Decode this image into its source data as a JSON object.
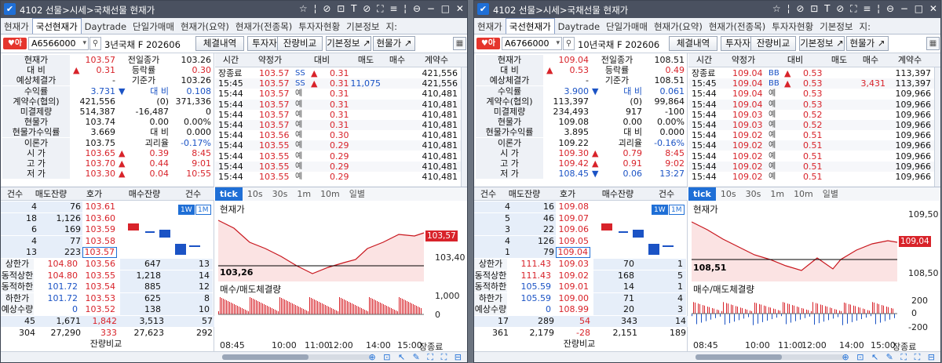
{
  "windows": [
    {
      "title": "4102 선물>시세>국채선물 현재가",
      "tabs": [
        "현재가",
        "국선현재가",
        "Daytrade",
        "단일가매매",
        "현재가(요약)",
        "현재가(전종목)",
        "투자자현황",
        "기본정보",
        "지:"
      ],
      "active_tab": 1,
      "code": "A6566000",
      "instrument": "3년국채 F 202606",
      "buttons": [
        "체결내역",
        "투자자",
        "잔량비교",
        "기본정보 ↗",
        "현물가 ↗"
      ],
      "summary": [
        {
          "label": "현재가",
          "value": "103.57",
          "color": "red",
          "label2": "전일종가",
          "value2": "103.26",
          "color2": ""
        },
        {
          "label": "대 비",
          "sign": "▲",
          "value": "0.31",
          "color": "red",
          "label2": "등락률",
          "value2": "0.30",
          "color2": "red"
        },
        {
          "label": "예상체결가",
          "value": "-",
          "color": "",
          "label2": "기준가",
          "value2": "103.26",
          "color2": ""
        },
        {
          "label": "수익률",
          "value": "3.731",
          "color": "blue",
          "label2": "대 비",
          "sign2": "▼",
          "value2": "0.108",
          "color2": "blue"
        },
        {
          "label": "계약수(협의)",
          "value": "421,556",
          "color": "",
          "label2": "(0)",
          "value2": "371,336",
          "color2": ""
        },
        {
          "label": "미결제량",
          "value": "514,387",
          "color": "",
          "label2": "-16,487",
          "value2": "0",
          "color2": ""
        },
        {
          "label": "현물가",
          "value": "103.74",
          "color": "",
          "label2": "0.00",
          "value2": "0.00%",
          "color2": ""
        },
        {
          "label": "현물가수익률",
          "value": "3.669",
          "color": "",
          "label2": "대 비",
          "value2": "0.000",
          "color2": ""
        },
        {
          "label": "이론가",
          "value": "103.75",
          "color": "",
          "label2": "괴리율",
          "value2": "-0.17%",
          "color2": "blue"
        },
        {
          "label": "시 가",
          "value": "103.65",
          "color": "red",
          "sign2": "▲",
          "label2": "0.39",
          "value2": "8:45",
          "color2": "red"
        },
        {
          "label": "고 가",
          "value": "103.70",
          "color": "red",
          "sign2": "▲",
          "label2": "0.44",
          "value2": "9:01",
          "color2": "red"
        },
        {
          "label": "저 가",
          "value": "103.30",
          "color": "red",
          "sign2": "▲",
          "label2": "0.04",
          "value2": "10:55",
          "color2": "red"
        }
      ],
      "trade_headers": [
        "시간",
        "약정가",
        "대비",
        "매도",
        "매수",
        "계약수"
      ],
      "trades": [
        {
          "time": "장종료",
          "price": "103.57",
          "tag": "SS",
          "sign": "▲",
          "chg": "0.31",
          "sell": "",
          "buy": "",
          "vol": "421,556"
        },
        {
          "time": "15:45",
          "price": "103.57",
          "tag": "SS",
          "sign": "▲",
          "chg": "0.31",
          "sell": "11,075",
          "buy": "",
          "vol": "421,556"
        },
        {
          "time": "15:44",
          "price": "103.57",
          "tag": "예",
          "sign": "",
          "chg": "0.31",
          "sell": "",
          "buy": "",
          "vol": "410,481"
        },
        {
          "time": "15:44",
          "price": "103.57",
          "tag": "예",
          "sign": "",
          "chg": "0.31",
          "sell": "",
          "buy": "",
          "vol": "410,481"
        },
        {
          "time": "15:44",
          "price": "103.57",
          "tag": "예",
          "sign": "",
          "chg": "0.31",
          "sell": "",
          "buy": "",
          "vol": "410,481"
        },
        {
          "time": "15:44",
          "price": "103.57",
          "tag": "예",
          "sign": "",
          "chg": "0.31",
          "sell": "",
          "buy": "",
          "vol": "410,481"
        },
        {
          "time": "15:44",
          "price": "103.56",
          "tag": "예",
          "sign": "",
          "chg": "0.30",
          "sell": "",
          "buy": "",
          "vol": "410,481"
        },
        {
          "time": "15:44",
          "price": "103.55",
          "tag": "예",
          "sign": "",
          "chg": "0.29",
          "sell": "",
          "buy": "",
          "vol": "410,481"
        },
        {
          "time": "15:44",
          "price": "103.55",
          "tag": "예",
          "sign": "",
          "chg": "0.29",
          "sell": "",
          "buy": "",
          "vol": "410,481"
        },
        {
          "time": "15:44",
          "price": "103.55",
          "tag": "예",
          "sign": "",
          "chg": "0.29",
          "sell": "",
          "buy": "",
          "vol": "410,481"
        },
        {
          "time": "15:44",
          "price": "103.55",
          "tag": "예",
          "sign": "",
          "chg": "0.29",
          "sell": "",
          "buy": "",
          "vol": "410,481"
        }
      ],
      "ob_headers": [
        "건수",
        "매도잔량",
        "호가",
        "매수잔량",
        "건수"
      ],
      "asks": [
        {
          "cnt": "4",
          "qty": "76",
          "price": "103.61"
        },
        {
          "cnt": "18",
          "qty": "1,126",
          "price": "103.60"
        },
        {
          "cnt": "6",
          "qty": "169",
          "price": "103.59"
        },
        {
          "cnt": "4",
          "qty": "77",
          "price": "103.58"
        },
        {
          "cnt": "13",
          "qty": "223",
          "price": "103.57"
        }
      ],
      "bids": [
        {
          "lab": "상한가",
          "lv": "104.80",
          "price": "103.56",
          "qty": "647",
          "cnt": "13"
        },
        {
          "lab": "동적상한",
          "lv": "104.80",
          "price": "103.55",
          "qty": "1,218",
          "cnt": "14"
        },
        {
          "lab": "동적하한",
          "lv": "101.72",
          "price": "103.54",
          "qty": "885",
          "cnt": "12"
        },
        {
          "lab": "하한가",
          "lv": "101.72",
          "price": "103.53",
          "qty": "625",
          "cnt": "8"
        },
        {
          "lab": "예상수량",
          "lv": "0",
          "price": "103.52",
          "qty": "138",
          "cnt": "10"
        }
      ],
      "ob_sum": {
        "c1": "45",
        "q1": "1,671",
        "mid": "1,842",
        "q2": "3,513",
        "c2": "57"
      },
      "ob_tot": {
        "c1": "304",
        "q1": "27,290",
        "mid": "333",
        "q2": "27,623",
        "c2": "292"
      },
      "ob_footer": "잔량비교",
      "chart_tabs": [
        "tick",
        "10s",
        "30s",
        "1m",
        "10m",
        "일별"
      ],
      "chart_current_label": "현재가",
      "chart_volume_label": "매수/매도체결량",
      "y_ticks": [
        "103,57",
        "103,40"
      ],
      "base_label": "103,26",
      "vol_ticks": [
        "1,000",
        "0"
      ],
      "x_ticks": [
        "08:45",
        "10:00",
        "11:00",
        "12:00",
        "14:00",
        "15:00",
        "장종료"
      ],
      "mini_labels": [
        "1W",
        "1M"
      ]
    },
    {
      "title": "4102 선물>시세>국채선물 현재가",
      "tabs": [
        "현재가",
        "국선현재가",
        "Daytrade",
        "단일가매매",
        "현재가(요약)",
        "현재가(전종목)",
        "투자자현황",
        "기본정보",
        "지:"
      ],
      "active_tab": 1,
      "code": "A6766000",
      "instrument": "10년국채 F 202606",
      "buttons": [
        "체결내역",
        "투자자",
        "잔량비교",
        "기본정보 ↗",
        "현물가 ↗"
      ],
      "summary": [
        {
          "label": "현재가",
          "value": "109.04",
          "color": "red",
          "label2": "전일종가",
          "value2": "108.51",
          "color2": ""
        },
        {
          "label": "대 비",
          "sign": "▲",
          "value": "0.53",
          "color": "red",
          "label2": "등락률",
          "value2": "0.49",
          "color2": "red"
        },
        {
          "label": "예상체결가",
          "value": "-",
          "color": "",
          "label2": "기준가",
          "value2": "108.51",
          "color2": ""
        },
        {
          "label": "수익률",
          "value": "3.900",
          "color": "blue",
          "label2": "대 비",
          "sign2": "▼",
          "value2": "0.061",
          "color2": "blue"
        },
        {
          "label": "계약수(협의)",
          "value": "113,397",
          "color": "",
          "label2": "(0)",
          "value2": "99,864",
          "color2": ""
        },
        {
          "label": "미결제량",
          "value": "234,493",
          "color": "",
          "label2": "917",
          "value2": "-100",
          "color2": ""
        },
        {
          "label": "현물가",
          "value": "109.08",
          "color": "",
          "label2": "0.00",
          "value2": "0.00%",
          "color2": ""
        },
        {
          "label": "현물가수익률",
          "value": "3.895",
          "color": "",
          "label2": "대 비",
          "value2": "0.000",
          "color2": ""
        },
        {
          "label": "이론가",
          "value": "109.22",
          "color": "",
          "label2": "괴리율",
          "value2": "-0.16%",
          "color2": "blue"
        },
        {
          "label": "시 가",
          "value": "109.30",
          "color": "red",
          "sign2": "▲",
          "label2": "0.79",
          "value2": "8:45",
          "color2": "red"
        },
        {
          "label": "고 가",
          "value": "109.42",
          "color": "red",
          "sign2": "▲",
          "label2": "0.91",
          "value2": "9:02",
          "color2": "red"
        },
        {
          "label": "저 가",
          "value": "108.45",
          "color": "blue",
          "sign2": "▼",
          "label2": "0.06",
          "value2": "13:27",
          "color2": "blue"
        }
      ],
      "trade_headers": [
        "시간",
        "약정가",
        "대비",
        "매도",
        "매수",
        "계약수"
      ],
      "trades": [
        {
          "time": "장종료",
          "price": "109.04",
          "tag": "BB",
          "sign": "▲",
          "chg": "0.53",
          "sell": "",
          "buy": "",
          "vol": "113,397"
        },
        {
          "time": "15:45",
          "price": "109.04",
          "tag": "BB",
          "sign": "▲",
          "chg": "0.53",
          "sell": "",
          "buy": "3,431",
          "vol": "113,397"
        },
        {
          "time": "15:44",
          "price": "109.04",
          "tag": "예",
          "sign": "",
          "chg": "0.53",
          "sell": "",
          "buy": "",
          "vol": "109,966"
        },
        {
          "time": "15:44",
          "price": "109.04",
          "tag": "예",
          "sign": "",
          "chg": "0.53",
          "sell": "",
          "buy": "",
          "vol": "109,966"
        },
        {
          "time": "15:44",
          "price": "109.03",
          "tag": "예",
          "sign": "",
          "chg": "0.52",
          "sell": "",
          "buy": "",
          "vol": "109,966"
        },
        {
          "time": "15:44",
          "price": "109.03",
          "tag": "예",
          "sign": "",
          "chg": "0.52",
          "sell": "",
          "buy": "",
          "vol": "109,966"
        },
        {
          "time": "15:44",
          "price": "109.02",
          "tag": "예",
          "sign": "",
          "chg": "0.51",
          "sell": "",
          "buy": "",
          "vol": "109,966"
        },
        {
          "time": "15:44",
          "price": "109.02",
          "tag": "예",
          "sign": "",
          "chg": "0.51",
          "sell": "",
          "buy": "",
          "vol": "109,966"
        },
        {
          "time": "15:44",
          "price": "109.02",
          "tag": "예",
          "sign": "",
          "chg": "0.51",
          "sell": "",
          "buy": "",
          "vol": "109,966"
        },
        {
          "time": "15:44",
          "price": "109.02",
          "tag": "예",
          "sign": "",
          "chg": "0.51",
          "sell": "",
          "buy": "",
          "vol": "109,966"
        },
        {
          "time": "15:44",
          "price": "109.02",
          "tag": "예",
          "sign": "",
          "chg": "0.51",
          "sell": "",
          "buy": "",
          "vol": "109,966"
        }
      ],
      "ob_headers": [
        "건수",
        "매도잔량",
        "호가",
        "매수잔량",
        "건수"
      ],
      "asks": [
        {
          "cnt": "4",
          "qty": "16",
          "price": "109.08"
        },
        {
          "cnt": "5",
          "qty": "46",
          "price": "109.07"
        },
        {
          "cnt": "3",
          "qty": "22",
          "price": "109.06"
        },
        {
          "cnt": "4",
          "qty": "126",
          "price": "109.05"
        },
        {
          "cnt": "1",
          "qty": "79",
          "price": "109.04"
        }
      ],
      "bids": [
        {
          "lab": "상한가",
          "lv": "111.43",
          "price": "109.03",
          "qty": "70",
          "cnt": "1"
        },
        {
          "lab": "동적상한",
          "lv": "111.43",
          "price": "109.02",
          "qty": "168",
          "cnt": "5"
        },
        {
          "lab": "동적하한",
          "lv": "105.59",
          "price": "109.01",
          "qty": "14",
          "cnt": "1"
        },
        {
          "lab": "하한가",
          "lv": "105.59",
          "price": "109.00",
          "qty": "71",
          "cnt": "4"
        },
        {
          "lab": "예상수량",
          "lv": "0",
          "price": "108.99",
          "qty": "20",
          "cnt": "3"
        }
      ],
      "ob_sum": {
        "c1": "17",
        "q1": "289",
        "mid": "54",
        "q2": "343",
        "c2": "14"
      },
      "ob_tot": {
        "c1": "361",
        "q1": "2,179",
        "mid": "-28",
        "q2": "2,151",
        "c2": "189"
      },
      "ob_footer": "잔량비교",
      "chart_tabs": [
        "tick",
        "10s",
        "30s",
        "1m",
        "10m",
        "일별"
      ],
      "chart_current_label": "현재가",
      "chart_volume_label": "매수/매도체결량",
      "y_ticks": [
        "109,50",
        "108,50"
      ],
      "base_label": "108,51",
      "vol_ticks": [
        "200",
        "0",
        "-200"
      ],
      "x_ticks": [
        "08:45",
        "10:00",
        "11:00",
        "12:00",
        "14:00",
        "15:00",
        "장종료"
      ],
      "mini_labels": [
        "1W",
        "1M"
      ]
    }
  ],
  "colors": {
    "up": "#d8232a",
    "down": "#1b53c5",
    "accent": "#1f6fd6",
    "titlebar": "#4a5160"
  }
}
